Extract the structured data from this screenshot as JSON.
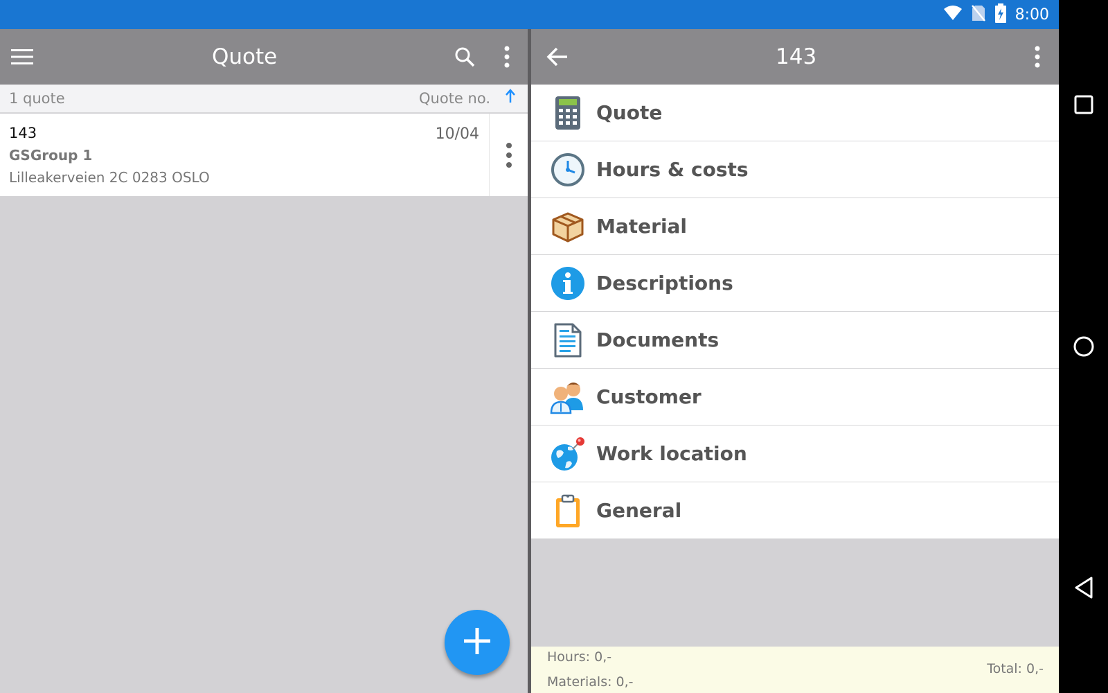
{
  "status_bar": {
    "time": "8:00",
    "icons": [
      "wifi-icon",
      "no-sim-icon",
      "battery-charging-icon"
    ]
  },
  "left_pane": {
    "toolbar": {
      "title": "Quote",
      "icons": [
        "hamburger-menu-icon",
        "search-icon",
        "more-vert-icon"
      ]
    },
    "list_header": {
      "count": "1 quote",
      "sort_label": "Quote no.",
      "sort_icon": "sort-ascending-arrow-icon"
    },
    "quotes": [
      {
        "number": "143",
        "date": "10/04",
        "customer": "GSGroup 1",
        "address": "Lilleakerveien 2C 0283 OSLO"
      }
    ],
    "fab_icon": "add-icon"
  },
  "right_pane": {
    "toolbar": {
      "title": "143",
      "icons": [
        "back-arrow-icon",
        "more-vert-icon"
      ]
    },
    "menu_items": [
      {
        "label": "Quote",
        "icon": "calculator-icon"
      },
      {
        "label": "Hours & costs",
        "icon": "clock-icon"
      },
      {
        "label": "Material",
        "icon": "box-icon"
      },
      {
        "label": "Descriptions",
        "icon": "info-icon"
      },
      {
        "label": "Documents",
        "icon": "document-icon"
      },
      {
        "label": "Customer",
        "icon": "customer-icon"
      },
      {
        "label": "Work location",
        "icon": "globe-pin-icon"
      },
      {
        "label": "General",
        "icon": "clipboard-icon"
      }
    ],
    "footer": {
      "hours": "Hours: 0,-",
      "materials": "Materials: 0,-",
      "total": "Total: 0,-"
    }
  },
  "nav_bar": {
    "icons": [
      "recents-square-icon",
      "home-circle-icon",
      "back-triangle-icon"
    ]
  },
  "colors": {
    "status_bar": "#1976d2",
    "toolbar": "#8a898c",
    "accent": "#2196f3",
    "background": "#d3d2d5",
    "footer": "#fbfbe6"
  }
}
